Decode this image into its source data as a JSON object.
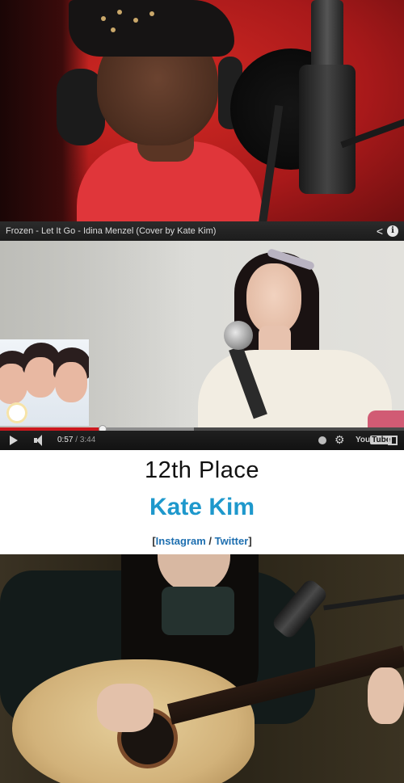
{
  "video": {
    "title": "Frozen - Let It Go - Idina Menzel (Cover by Kate Kim)",
    "share_icon": "share-icon",
    "info_icon": "info-icon",
    "info_glyph": "i",
    "current_time": "0:57",
    "time_separator": " / ",
    "duration": "3:44",
    "progress_fraction": 0.254,
    "logo_you": "You",
    "logo_tube": "Tube",
    "progress_color": "#cc181e"
  },
  "ranking": {
    "place": "12th Place",
    "artist": "Kate Kim",
    "links_open": "[",
    "instagram_label": "Instagram",
    "links_separator": " / ",
    "twitter_label": "Twitter",
    "links_close": "]",
    "artist_color": "#1e98cc"
  }
}
